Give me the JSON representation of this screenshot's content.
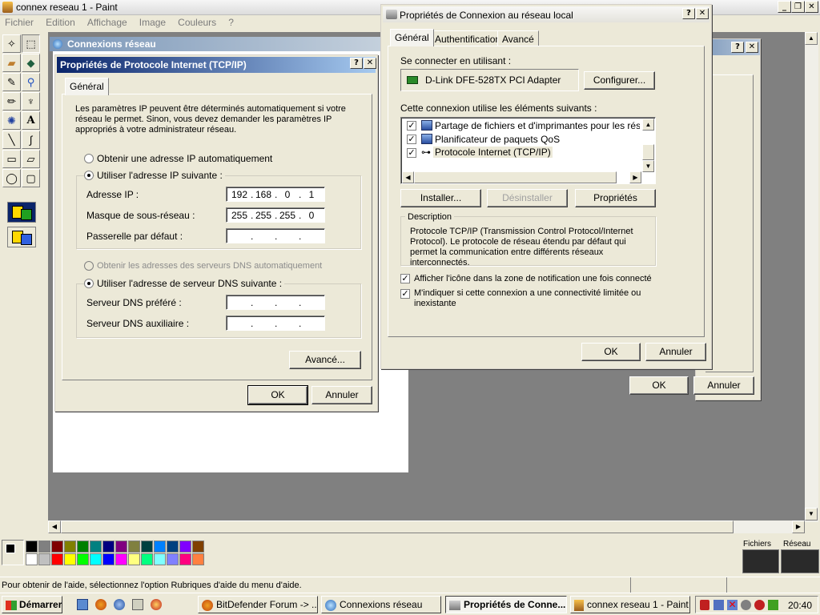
{
  "paint": {
    "title": "connex reseau 1 - Paint",
    "menu": [
      "Fichier",
      "Edition",
      "Affichage",
      "Image",
      "Couleurs",
      "?"
    ],
    "status": "Pour obtenir de l'aide, sélectionnez l'option Rubriques d'aide du menu d'aide."
  },
  "net_window": {
    "title": "Connexions réseau"
  },
  "tcpip": {
    "title": "Propriétés de Protocole Internet (TCP/IP)",
    "tab": "Général",
    "intro": "Les paramètres IP peuvent être déterminés automatiquement si votre réseau le permet. Sinon, vous devez demander les paramètres IP appropriés à votre administrateur réseau.",
    "auto_ip": "Obtenir une adresse IP automatiquement",
    "use_ip": "Utiliser l'adresse IP suivante :",
    "ip_label": "Adresse IP :",
    "ip": [
      "192",
      "168",
      "0",
      "1"
    ],
    "mask_label": "Masque de sous-réseau :",
    "mask": [
      "255",
      "255",
      "255",
      "0"
    ],
    "gw_label": "Passerelle par défaut :",
    "auto_dns": "Obtenir les adresses des serveurs DNS automatiquement",
    "use_dns": "Utiliser l'adresse de serveur DNS suivante :",
    "dns1_label": "Serveur DNS préféré :",
    "dns2_label": "Serveur DNS auxiliaire :",
    "advanced": "Avancé...",
    "ok": "OK",
    "cancel": "Annuler"
  },
  "lan": {
    "title": "Propriétés de Connexion au réseau local",
    "tabs": [
      "Général",
      "Authentification",
      "Avancé"
    ],
    "connect_using": "Se connecter en utilisant :",
    "adapter": "D-Link DFE-528TX PCI Adapter",
    "configure": "Configurer...",
    "uses_items": "Cette connexion utilise les éléments suivants :",
    "items": [
      "Partage de fichiers et d'imprimantes pour les réseaux M",
      "Planificateur de paquets QoS",
      "Protocole Internet (TCP/IP)"
    ],
    "install": "Installer...",
    "uninstall": "Désinstaller",
    "properties": "Propriétés",
    "desc_label": "Description",
    "desc": "Protocole TCP/IP (Transmission Control Protocol/Internet Protocol). Le protocole de réseau étendu par défaut qui permet la communication entre différents réseaux interconnectés.",
    "show_icon": "Afficher l'icône dans la zone de notification une fois connecté",
    "notify": "M'indiquer si cette connexion a une connectivité limitée ou inexistante",
    "ok": "OK",
    "cancel": "Annuler"
  },
  "back_dialog": {
    "ok": "OK",
    "cancel": "Annuler"
  },
  "netmon": {
    "files": "Fichiers",
    "network": "Réseau"
  },
  "taskbar": {
    "start": "Démarrer",
    "tasks": [
      "BitDefender Forum -> ...",
      "Connexions réseau",
      "Propriétés de Conne...",
      "connex reseau 1 - Paint"
    ],
    "clock": "20:40"
  },
  "palette": [
    "#000000",
    "#808080",
    "#800000",
    "#808000",
    "#008000",
    "#008080",
    "#000080",
    "#800080",
    "#808040",
    "#004040",
    "#0080ff",
    "#004080",
    "#8000ff",
    "#804000",
    "#ffffff",
    "#c0c0c0",
    "#ff0000",
    "#ffff00",
    "#00ff00",
    "#00ffff",
    "#0000ff",
    "#ff00ff",
    "#ffff80",
    "#00ff80",
    "#80ffff",
    "#8080ff",
    "#ff0080",
    "#ff8040"
  ]
}
